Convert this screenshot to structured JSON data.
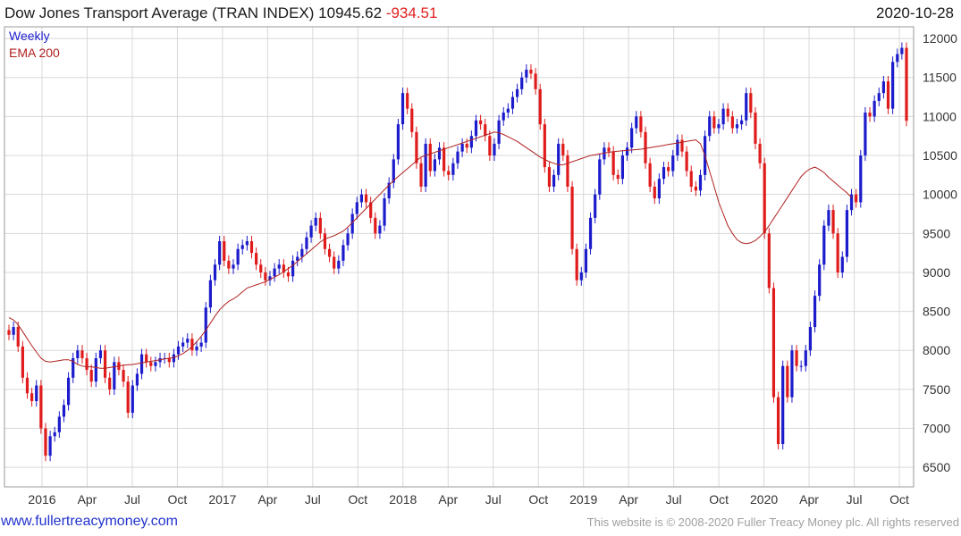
{
  "header": {
    "title": "Dow Jones Transport Average (TRAN INDEX)",
    "last": "10945.62",
    "change": "-934.51",
    "date": "2020-10-28"
  },
  "footer": {
    "site_link": "www.fullertreacymoney.com",
    "copyright": "This website is © 2008-2020 Fuller Treacy Money plc. All rights reserved"
  },
  "colors": {
    "up": "#1c1ccc",
    "down": "#e01b1b",
    "ema": "#b02020",
    "grid": "#d8d8d8"
  },
  "chart_data": {
    "type": "candlestick",
    "frequency": "weekly",
    "legend": [
      {
        "label": "Weekly",
        "color": "#1c1ccc"
      },
      {
        "label": "EMA 200",
        "color": "#b02020"
      }
    ],
    "x_tick_labels": [
      "2016",
      "Apr",
      "Jul",
      "Oct",
      "2017",
      "Apr",
      "Jul",
      "Oct",
      "2018",
      "Apr",
      "Jul",
      "Oct",
      "2019",
      "Apr",
      "Jul",
      "Oct",
      "2020",
      "Apr",
      "Jul",
      "Oct"
    ],
    "ylim": [
      6250,
      12150
    ],
    "y_ticks": [
      6500,
      7000,
      7500,
      8000,
      8500,
      9000,
      9500,
      10000,
      10500,
      11000,
      11500,
      12000
    ],
    "close": [
      8200,
      8300,
      8050,
      7650,
      7450,
      7350,
      7550,
      7000,
      6650,
      6900,
      6950,
      7150,
      7300,
      7650,
      7900,
      8000,
      7900,
      7750,
      7600,
      7900,
      8000,
      7650,
      7500,
      7850,
      7750,
      7600,
      7200,
      7550,
      7700,
      7950,
      7850,
      7800,
      7850,
      7900,
      7900,
      7850,
      7950,
      8050,
      8100,
      8150,
      8000,
      8050,
      8100,
      8550,
      8900,
      9100,
      9400,
      9150,
      9050,
      9100,
      9300,
      9350,
      9400,
      9250,
      9100,
      9000,
      8900,
      8950,
      9050,
      9100,
      9000,
      8950,
      9150,
      9200,
      9300,
      9450,
      9600,
      9700,
      9500,
      9300,
      9200,
      9050,
      9150,
      9350,
      9500,
      9750,
      9900,
      10000,
      9900,
      9700,
      9500,
      9600,
      9950,
      10150,
      10450,
      10900,
      11300,
      11100,
      10800,
      10400,
      10100,
      10650,
      10300,
      10450,
      10600,
      10300,
      10250,
      10400,
      10550,
      10650,
      10600,
      10750,
      10950,
      10900,
      10750,
      10500,
      10650,
      10950,
      11050,
      11100,
      11250,
      11350,
      11500,
      11600,
      11550,
      11350,
      10900,
      10350,
      10100,
      10250,
      10650,
      10500,
      10100,
      9300,
      8900,
      9000,
      9300,
      9700,
      10000,
      10450,
      10600,
      10550,
      10250,
      10200,
      10500,
      10600,
      10850,
      11000,
      10800,
      10400,
      10100,
      9950,
      10200,
      10350,
      10300,
      10500,
      10700,
      10550,
      10300,
      10100,
      10050,
      10250,
      10750,
      11000,
      10850,
      10900,
      11100,
      11000,
      10850,
      10900,
      10950,
      11300,
      11050,
      10650,
      10400,
      9500,
      8800,
      7400,
      6800,
      7800,
      7400,
      8000,
      7800,
      7800,
      8000,
      8300,
      8700,
      9100,
      9600,
      9800,
      9500,
      9000,
      9200,
      9800,
      10000,
      9900,
      10500,
      11050,
      11000,
      11200,
      11300,
      11450,
      11100,
      11700,
      11800,
      11880,
      10945
    ],
    "ema": [
      8420,
      8390,
      8330,
      8240,
      8150,
      8060,
      7980,
      7900,
      7860,
      7850,
      7860,
      7870,
      7880,
      7880,
      7860,
      7820,
      7800,
      7790,
      7790,
      7780,
      7770,
      7770,
      7780,
      7790,
      7800,
      7810,
      7815,
      7820,
      7830,
      7840,
      7850,
      7860,
      7870,
      7880,
      7890,
      7900,
      7910,
      7930,
      7960,
      8000,
      8050,
      8110,
      8180,
      8260,
      8350,
      8440,
      8520,
      8580,
      8630,
      8660,
      8700,
      8750,
      8800,
      8820,
      8840,
      8860,
      8880,
      8910,
      8940,
      8970,
      9010,
      9050,
      9090,
      9140,
      9190,
      9240,
      9290,
      9340,
      9390,
      9430,
      9450,
      9470,
      9500,
      9530,
      9580,
      9640,
      9700,
      9760,
      9820,
      9880,
      9940,
      10000,
      10060,
      10120,
      10180,
      10230,
      10280,
      10330,
      10380,
      10430,
      10480,
      10500,
      10520,
      10540,
      10560,
      10580,
      10600,
      10620,
      10640,
      10660,
      10680,
      10700,
      10720,
      10740,
      10760,
      10780,
      10800,
      10790,
      10770,
      10740,
      10710,
      10680,
      10640,
      10600,
      10560,
      10520,
      10480,
      10450,
      10420,
      10400,
      10380,
      10380,
      10400,
      10420,
      10440,
      10460,
      10480,
      10500,
      10510,
      10520,
      10530,
      10540,
      10550,
      10555,
      10560,
      10565,
      10570,
      10575,
      10580,
      10590,
      10600,
      10610,
      10620,
      10630,
      10640,
      10650,
      10660,
      10670,
      10680,
      10690,
      10700,
      10650,
      10500,
      10300,
      10100,
      9900,
      9750,
      9600,
      9500,
      9420,
      9380,
      9370,
      9380,
      9410,
      9460,
      9520,
      9600,
      9690,
      9780,
      9870,
      9960,
      10050,
      10140,
      10230,
      10290,
      10330,
      10350,
      10320,
      10280,
      10220,
      10170,
      10120,
      10070,
      10020,
      9960
    ]
  }
}
